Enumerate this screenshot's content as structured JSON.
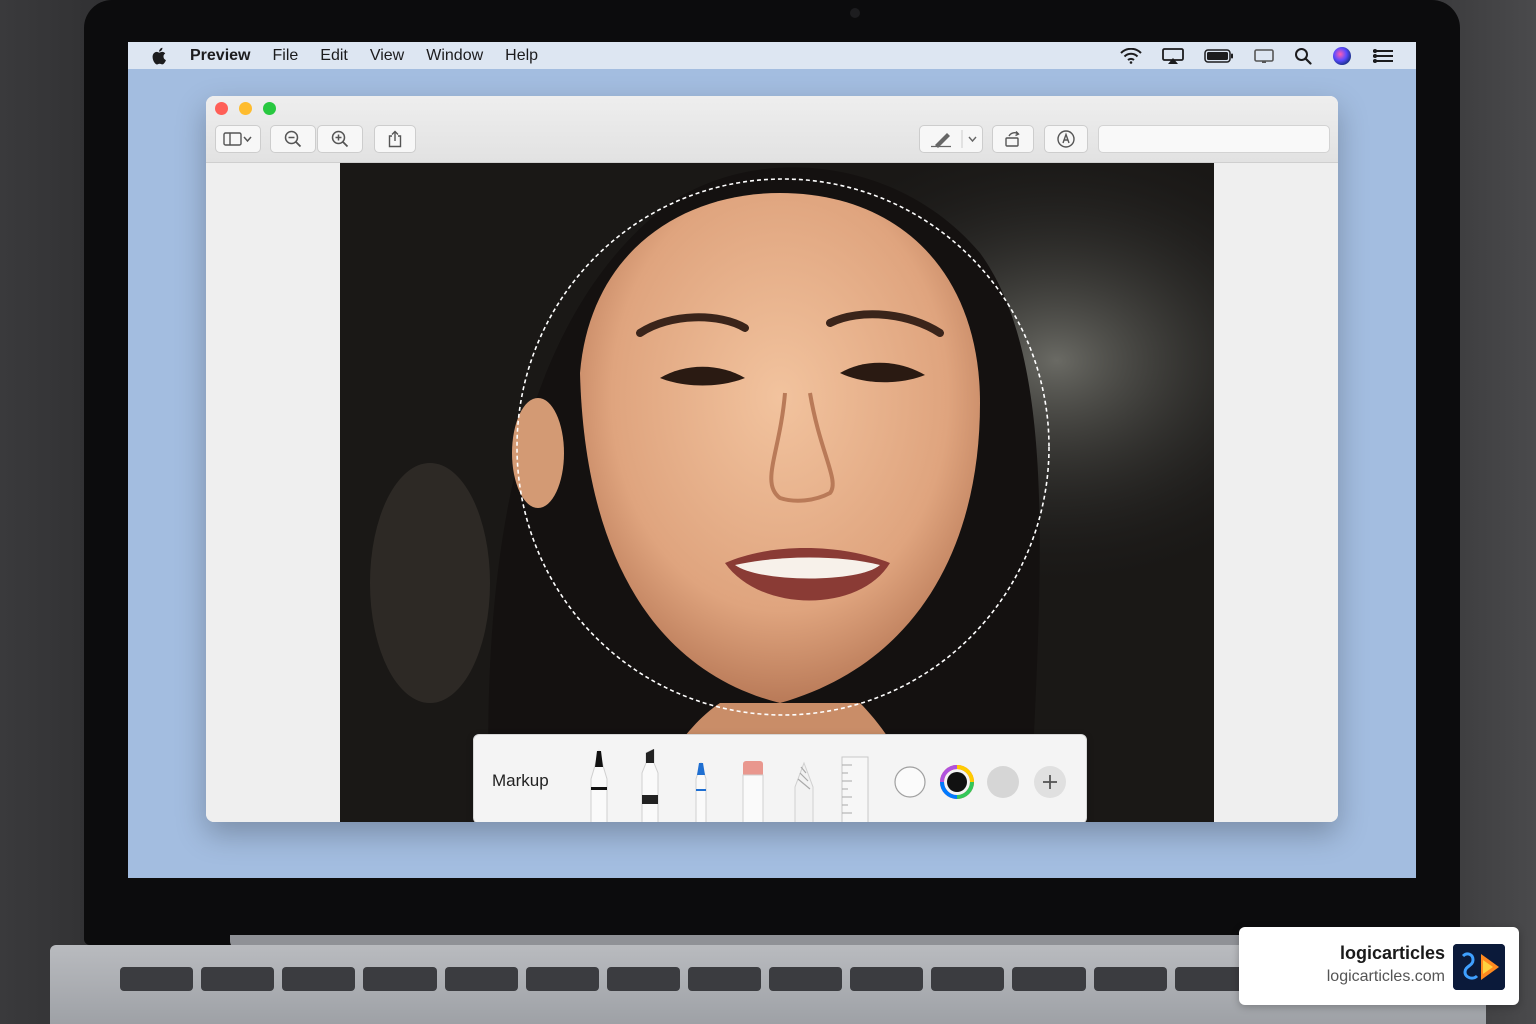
{
  "menubar": {
    "app_name": "Preview",
    "items": [
      "File",
      "Edit",
      "View",
      "Window",
      "Help"
    ]
  },
  "markup": {
    "label": "Markup"
  },
  "badge": {
    "title": "logicarticles",
    "url": "logicarticles.com"
  },
  "colors": {
    "desktop": "#a3bde0",
    "close": "#ff5f57",
    "minimize": "#febc2e",
    "zoom": "#28c840"
  }
}
